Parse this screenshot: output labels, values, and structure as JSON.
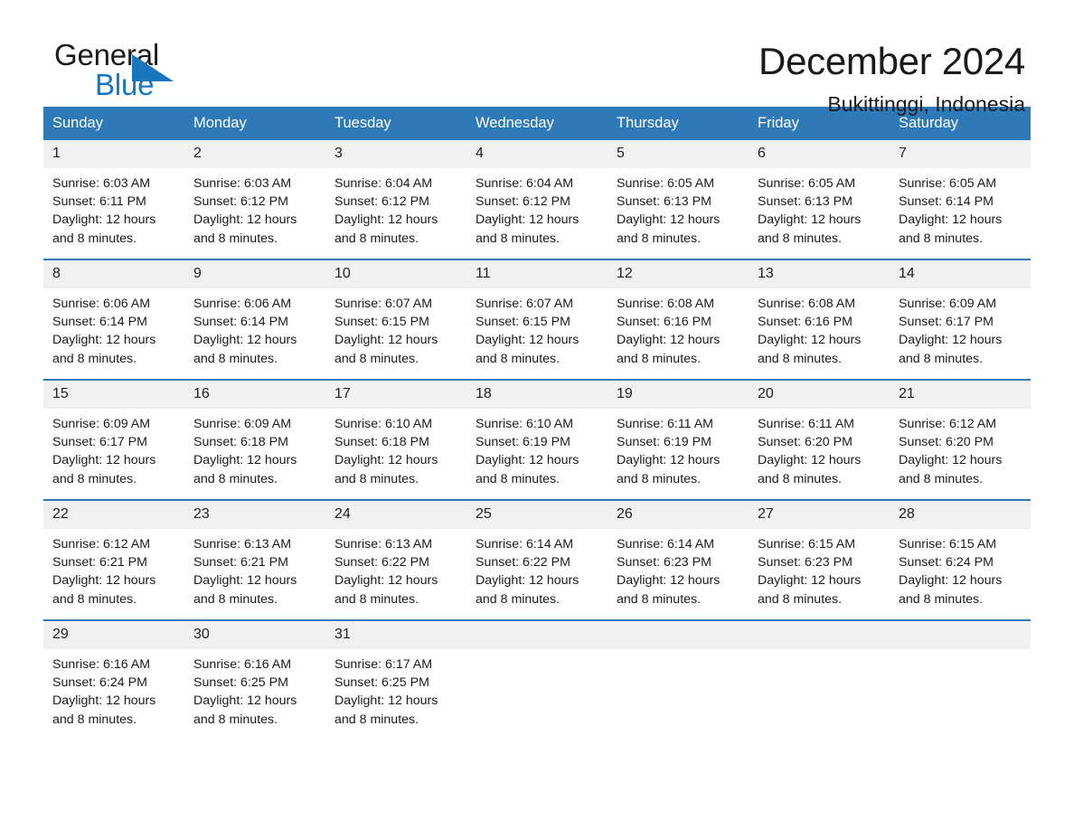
{
  "brand": {
    "name_part1": "General",
    "name_part2": "Blue",
    "accent_color": "#1a76bc",
    "header_color": "#2e7ab8"
  },
  "header": {
    "title": "December 2024",
    "location": "Bukittinggi, Indonesia"
  },
  "calendar": {
    "weekdays": [
      "Sunday",
      "Monday",
      "Tuesday",
      "Wednesday",
      "Thursday",
      "Friday",
      "Saturday"
    ],
    "labels": {
      "sunrise_prefix": "Sunrise: ",
      "sunset_prefix": "Sunset: ",
      "daylight_prefix": "Daylight: "
    },
    "weeks": [
      [
        {
          "day": "1",
          "sunrise": "Sunrise: 6:03 AM",
          "sunset": "Sunset: 6:11 PM",
          "daylight": "Daylight: 12 hours and 8 minutes."
        },
        {
          "day": "2",
          "sunrise": "Sunrise: 6:03 AM",
          "sunset": "Sunset: 6:12 PM",
          "daylight": "Daylight: 12 hours and 8 minutes."
        },
        {
          "day": "3",
          "sunrise": "Sunrise: 6:04 AM",
          "sunset": "Sunset: 6:12 PM",
          "daylight": "Daylight: 12 hours and 8 minutes."
        },
        {
          "day": "4",
          "sunrise": "Sunrise: 6:04 AM",
          "sunset": "Sunset: 6:12 PM",
          "daylight": "Daylight: 12 hours and 8 minutes."
        },
        {
          "day": "5",
          "sunrise": "Sunrise: 6:05 AM",
          "sunset": "Sunset: 6:13 PM",
          "daylight": "Daylight: 12 hours and 8 minutes."
        },
        {
          "day": "6",
          "sunrise": "Sunrise: 6:05 AM",
          "sunset": "Sunset: 6:13 PM",
          "daylight": "Daylight: 12 hours and 8 minutes."
        },
        {
          "day": "7",
          "sunrise": "Sunrise: 6:05 AM",
          "sunset": "Sunset: 6:14 PM",
          "daylight": "Daylight: 12 hours and 8 minutes."
        }
      ],
      [
        {
          "day": "8",
          "sunrise": "Sunrise: 6:06 AM",
          "sunset": "Sunset: 6:14 PM",
          "daylight": "Daylight: 12 hours and 8 minutes."
        },
        {
          "day": "9",
          "sunrise": "Sunrise: 6:06 AM",
          "sunset": "Sunset: 6:14 PM",
          "daylight": "Daylight: 12 hours and 8 minutes."
        },
        {
          "day": "10",
          "sunrise": "Sunrise: 6:07 AM",
          "sunset": "Sunset: 6:15 PM",
          "daylight": "Daylight: 12 hours and 8 minutes."
        },
        {
          "day": "11",
          "sunrise": "Sunrise: 6:07 AM",
          "sunset": "Sunset: 6:15 PM",
          "daylight": "Daylight: 12 hours and 8 minutes."
        },
        {
          "day": "12",
          "sunrise": "Sunrise: 6:08 AM",
          "sunset": "Sunset: 6:16 PM",
          "daylight": "Daylight: 12 hours and 8 minutes."
        },
        {
          "day": "13",
          "sunrise": "Sunrise: 6:08 AM",
          "sunset": "Sunset: 6:16 PM",
          "daylight": "Daylight: 12 hours and 8 minutes."
        },
        {
          "day": "14",
          "sunrise": "Sunrise: 6:09 AM",
          "sunset": "Sunset: 6:17 PM",
          "daylight": "Daylight: 12 hours and 8 minutes."
        }
      ],
      [
        {
          "day": "15",
          "sunrise": "Sunrise: 6:09 AM",
          "sunset": "Sunset: 6:17 PM",
          "daylight": "Daylight: 12 hours and 8 minutes."
        },
        {
          "day": "16",
          "sunrise": "Sunrise: 6:09 AM",
          "sunset": "Sunset: 6:18 PM",
          "daylight": "Daylight: 12 hours and 8 minutes."
        },
        {
          "day": "17",
          "sunrise": "Sunrise: 6:10 AM",
          "sunset": "Sunset: 6:18 PM",
          "daylight": "Daylight: 12 hours and 8 minutes."
        },
        {
          "day": "18",
          "sunrise": "Sunrise: 6:10 AM",
          "sunset": "Sunset: 6:19 PM",
          "daylight": "Daylight: 12 hours and 8 minutes."
        },
        {
          "day": "19",
          "sunrise": "Sunrise: 6:11 AM",
          "sunset": "Sunset: 6:19 PM",
          "daylight": "Daylight: 12 hours and 8 minutes."
        },
        {
          "day": "20",
          "sunrise": "Sunrise: 6:11 AM",
          "sunset": "Sunset: 6:20 PM",
          "daylight": "Daylight: 12 hours and 8 minutes."
        },
        {
          "day": "21",
          "sunrise": "Sunrise: 6:12 AM",
          "sunset": "Sunset: 6:20 PM",
          "daylight": "Daylight: 12 hours and 8 minutes."
        }
      ],
      [
        {
          "day": "22",
          "sunrise": "Sunrise: 6:12 AM",
          "sunset": "Sunset: 6:21 PM",
          "daylight": "Daylight: 12 hours and 8 minutes."
        },
        {
          "day": "23",
          "sunrise": "Sunrise: 6:13 AM",
          "sunset": "Sunset: 6:21 PM",
          "daylight": "Daylight: 12 hours and 8 minutes."
        },
        {
          "day": "24",
          "sunrise": "Sunrise: 6:13 AM",
          "sunset": "Sunset: 6:22 PM",
          "daylight": "Daylight: 12 hours and 8 minutes."
        },
        {
          "day": "25",
          "sunrise": "Sunrise: 6:14 AM",
          "sunset": "Sunset: 6:22 PM",
          "daylight": "Daylight: 12 hours and 8 minutes."
        },
        {
          "day": "26",
          "sunrise": "Sunrise: 6:14 AM",
          "sunset": "Sunset: 6:23 PM",
          "daylight": "Daylight: 12 hours and 8 minutes."
        },
        {
          "day": "27",
          "sunrise": "Sunrise: 6:15 AM",
          "sunset": "Sunset: 6:23 PM",
          "daylight": "Daylight: 12 hours and 8 minutes."
        },
        {
          "day": "28",
          "sunrise": "Sunrise: 6:15 AM",
          "sunset": "Sunset: 6:24 PM",
          "daylight": "Daylight: 12 hours and 8 minutes."
        }
      ],
      [
        {
          "day": "29",
          "sunrise": "Sunrise: 6:16 AM",
          "sunset": "Sunset: 6:24 PM",
          "daylight": "Daylight: 12 hours and 8 minutes."
        },
        {
          "day": "30",
          "sunrise": "Sunrise: 6:16 AM",
          "sunset": "Sunset: 6:25 PM",
          "daylight": "Daylight: 12 hours and 8 minutes."
        },
        {
          "day": "31",
          "sunrise": "Sunrise: 6:17 AM",
          "sunset": "Sunset: 6:25 PM",
          "daylight": "Daylight: 12 hours and 8 minutes."
        },
        {
          "day": "",
          "sunrise": "",
          "sunset": "",
          "daylight": ""
        },
        {
          "day": "",
          "sunrise": "",
          "sunset": "",
          "daylight": ""
        },
        {
          "day": "",
          "sunrise": "",
          "sunset": "",
          "daylight": ""
        },
        {
          "day": "",
          "sunrise": "",
          "sunset": "",
          "daylight": ""
        }
      ]
    ]
  }
}
